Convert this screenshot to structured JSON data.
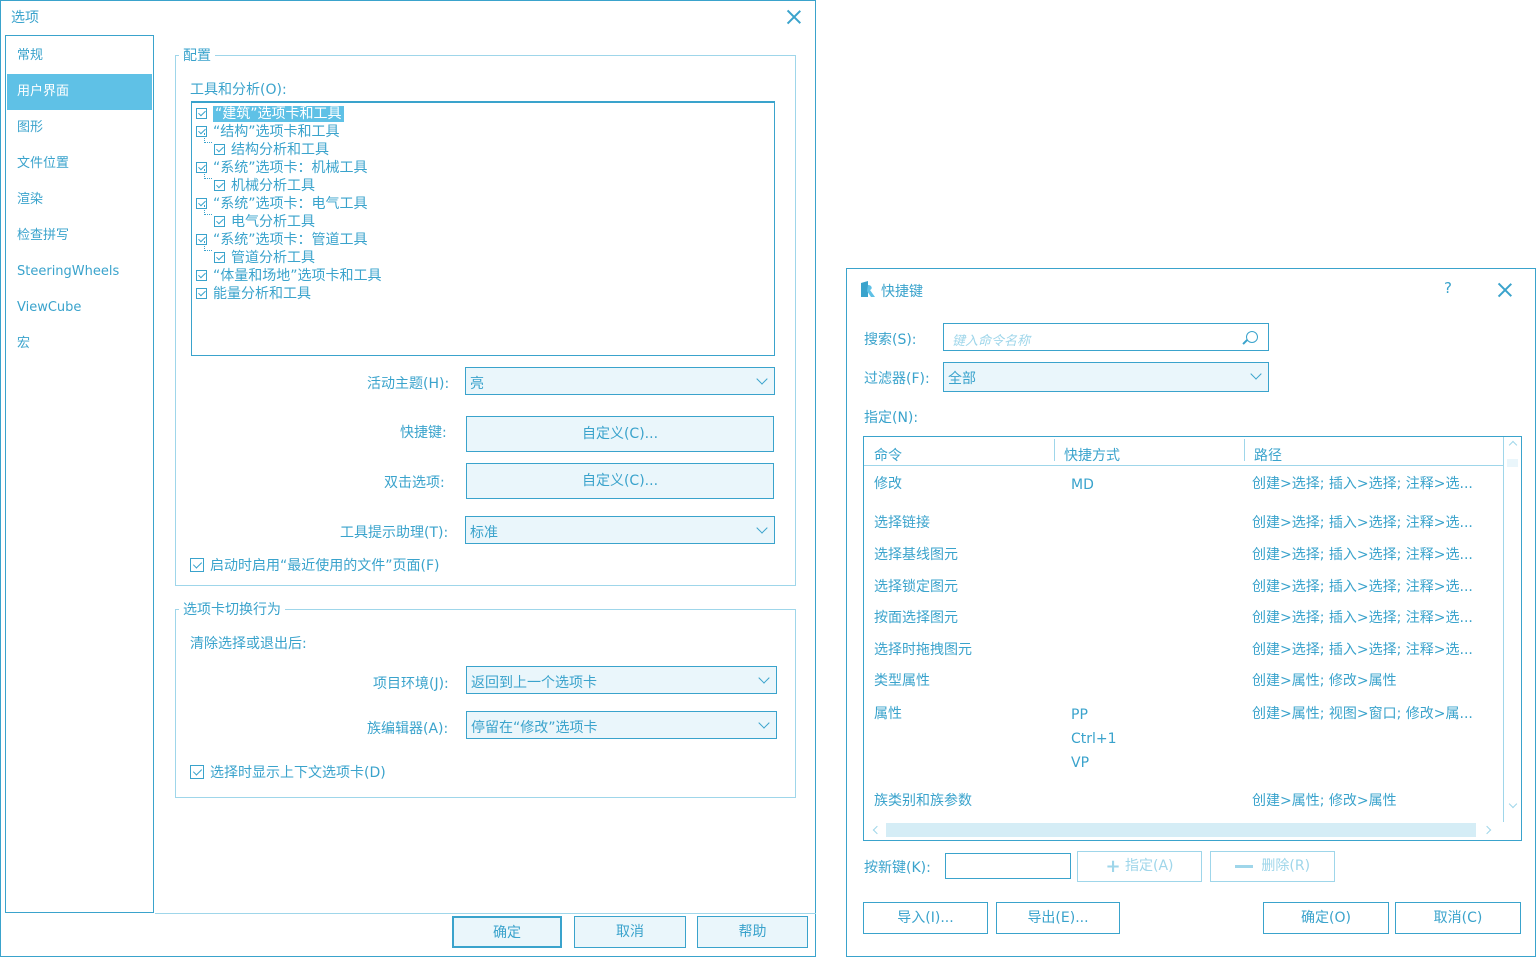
{
  "options": {
    "title": "选项",
    "nav": [
      "常规",
      "用户界面",
      "图形",
      "文件位置",
      "渲染",
      "检查拼写",
      "SteeringWheels",
      "ViewCube",
      "宏"
    ],
    "config_title": "配置",
    "tools_label": "工具和分析(O):",
    "tools": [
      {
        "label": "“建筑”选项卡和工具",
        "checked": true
      },
      {
        "label": "“结构”选项卡和工具",
        "checked": true
      },
      {
        "label": "结构分析和工具",
        "checked": true
      },
      {
        "label": "“系统”选项卡：机械工具",
        "checked": true
      },
      {
        "label": "机械分析工具",
        "checked": true
      },
      {
        "label": "“系统”选项卡：电气工具",
        "checked": true
      },
      {
        "label": "电气分析工具",
        "checked": true
      },
      {
        "label": "“系统”选项卡：管道工具",
        "checked": true
      },
      {
        "label": "管道分析工具",
        "checked": true
      },
      {
        "label": "“体量和场地”选项卡和工具",
        "checked": true
      },
      {
        "label": "能量分析和工具",
        "checked": true
      }
    ],
    "theme_label": "活动主题(H):",
    "theme_value": "亮",
    "shortcuts_label": "快捷键:",
    "shortcuts_button": "自定义(C)...",
    "dblclick_label": "双击选项:",
    "dblclick_button": "自定义(C)...",
    "tooltip_label": "工具提示助理(T):",
    "tooltip_value": "标准",
    "recent_files_label": "启动时启用“最近使用的文件”页面(F)",
    "tab_switch_title": "选项卡切换行为",
    "after_clear_label": "清除选择或退出后:",
    "project_label": "项目环境(J):",
    "project_value": "返回到上一个选项卡",
    "family_label": "族编辑器(A):",
    "family_value": "停留在“修改”选项卡",
    "context_tab_label": "选择时显示上下文选项卡(D)",
    "ok": "确定",
    "cancel": "取消",
    "help": "帮助"
  },
  "keys": {
    "title": "快捷键",
    "help": "?",
    "search_label": "搜索(S):",
    "search_placeholder": "键入命令名称",
    "filter_label": "过滤器(F):",
    "filter_value": "全部",
    "assign_label": "指定(N):",
    "columns": [
      "命令",
      "快捷方式",
      "路径"
    ],
    "rows": [
      {
        "cmd": "修改",
        "keys": [
          "MD"
        ],
        "path": "创建>选择; 插入>选择; 注释>选..."
      },
      {
        "cmd": "选择链接",
        "keys": [],
        "path": "创建>选择; 插入>选择; 注释>选..."
      },
      {
        "cmd": "选择基线图元",
        "keys": [],
        "path": "创建>选择; 插入>选择; 注释>选..."
      },
      {
        "cmd": "选择锁定图元",
        "keys": [],
        "path": "创建>选择; 插入>选择; 注释>选..."
      },
      {
        "cmd": "按面选择图元",
        "keys": [],
        "path": "创建>选择; 插入>选择; 注释>选..."
      },
      {
        "cmd": "选择时拖拽图元",
        "keys": [],
        "path": "创建>选择; 插入>选择; 注释>选..."
      },
      {
        "cmd": "类型属性",
        "keys": [],
        "path": "创建>属性; 修改>属性"
      },
      {
        "cmd": "属性",
        "keys": [
          "PP",
          "Ctrl+1",
          "VP"
        ],
        "path": "创建>属性; 视图>窗口; 修改>属..."
      },
      {
        "cmd": "族类别和族参数",
        "keys": [],
        "path": "创建>属性; 修改>属性"
      }
    ],
    "new_key_label": "按新键(K):",
    "assign_button": "指定(A)",
    "remove_button": "删除(R)",
    "import_button": "导入(I)...",
    "export_button": "导出(E)...",
    "ok": "确定(O)",
    "cancel": "取消(C)"
  }
}
